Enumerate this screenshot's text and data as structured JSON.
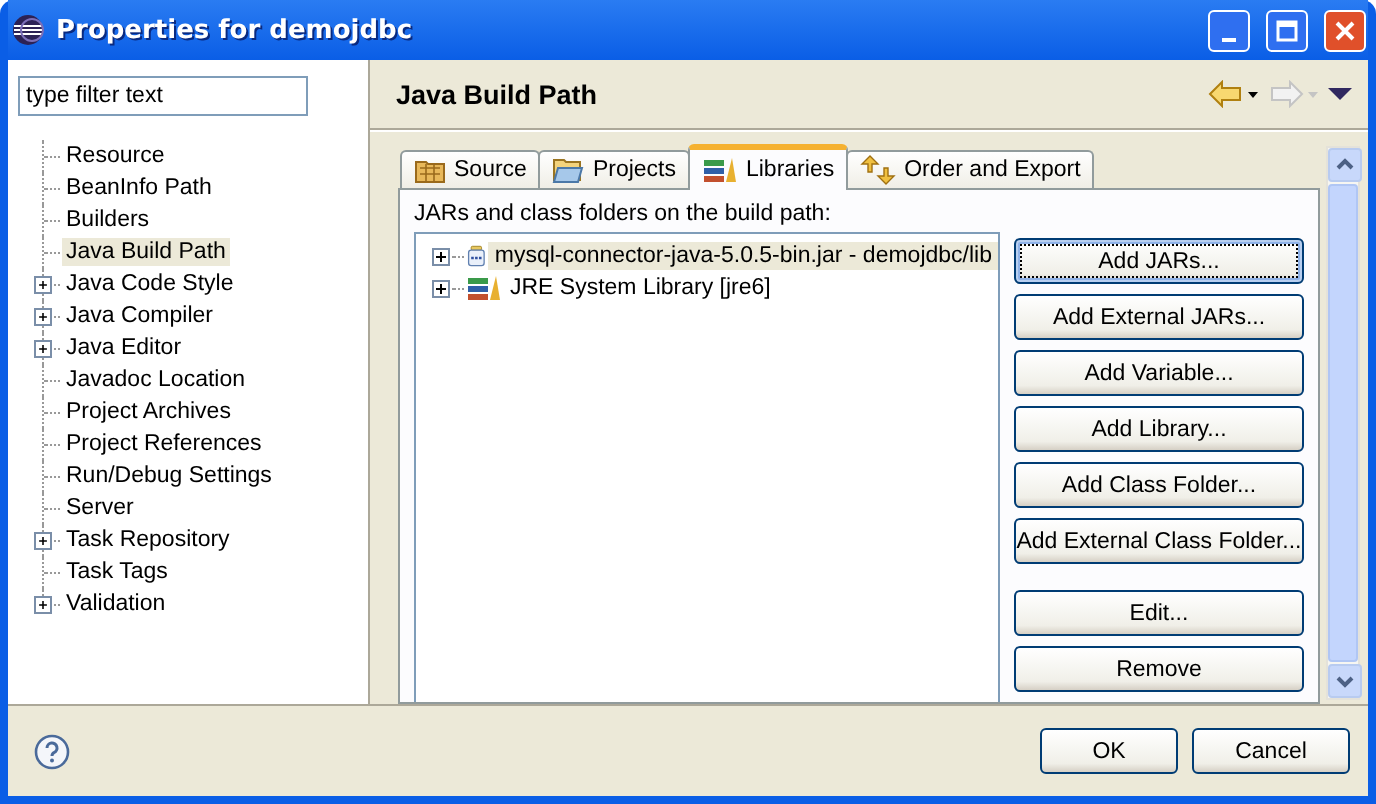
{
  "window": {
    "title": "Properties for demojdbc"
  },
  "filter": {
    "placeholder": "type filter text"
  },
  "sidebar": {
    "items": [
      {
        "label": "Resource",
        "expandable": false,
        "selected": false
      },
      {
        "label": "BeanInfo Path",
        "expandable": false,
        "selected": false
      },
      {
        "label": "Builders",
        "expandable": false,
        "selected": false
      },
      {
        "label": "Java Build Path",
        "expandable": false,
        "selected": true
      },
      {
        "label": "Java Code Style",
        "expandable": true,
        "selected": false
      },
      {
        "label": "Java Compiler",
        "expandable": true,
        "selected": false
      },
      {
        "label": "Java Editor",
        "expandable": true,
        "selected": false
      },
      {
        "label": "Javadoc Location",
        "expandable": false,
        "selected": false
      },
      {
        "label": "Project Archives",
        "expandable": false,
        "selected": false
      },
      {
        "label": "Project References",
        "expandable": false,
        "selected": false
      },
      {
        "label": "Run/Debug Settings",
        "expandable": false,
        "selected": false
      },
      {
        "label": "Server",
        "expandable": false,
        "selected": false
      },
      {
        "label": "Task Repository",
        "expandable": true,
        "selected": false
      },
      {
        "label": "Task Tags",
        "expandable": false,
        "selected": false
      },
      {
        "label": "Validation",
        "expandable": true,
        "selected": false
      }
    ]
  },
  "page": {
    "title": "Java Build Path",
    "nav": [
      {
        "kind": "back",
        "disabled": false
      },
      {
        "kind": "forward",
        "disabled": true
      },
      {
        "kind": "menu",
        "disabled": false
      }
    ],
    "tabs": [
      {
        "label": "Source",
        "kind": "source",
        "selected": false
      },
      {
        "label": "Projects",
        "kind": "projects",
        "selected": false
      },
      {
        "label": "Libraries",
        "kind": "libraries",
        "selected": true
      },
      {
        "label": "Order and Export",
        "kind": "order",
        "selected": false
      }
    ],
    "list_label": "JARs and class folders on the build path:",
    "entries": [
      {
        "label": "mysql-connector-java-5.0.5-bin.jar - demojdbc/lib",
        "kind": "jar",
        "selected": true
      },
      {
        "label": "JRE System Library [jre6]",
        "kind": "library",
        "selected": false
      }
    ],
    "button_groups": [
      [
        {
          "label": "Add JARs...",
          "focused": true
        },
        {
          "label": "Add External JARs...",
          "focused": false
        },
        {
          "label": "Add Variable...",
          "focused": false
        },
        {
          "label": "Add Library...",
          "focused": false
        },
        {
          "label": "Add Class Folder...",
          "focused": false
        },
        {
          "label": "Add External Class Folder...",
          "focused": false
        }
      ],
      [
        {
          "label": "Edit...",
          "focused": false
        },
        {
          "label": "Remove",
          "focused": false
        }
      ]
    ]
  },
  "footer": {
    "buttons": [
      "OK",
      "Cancel"
    ]
  }
}
